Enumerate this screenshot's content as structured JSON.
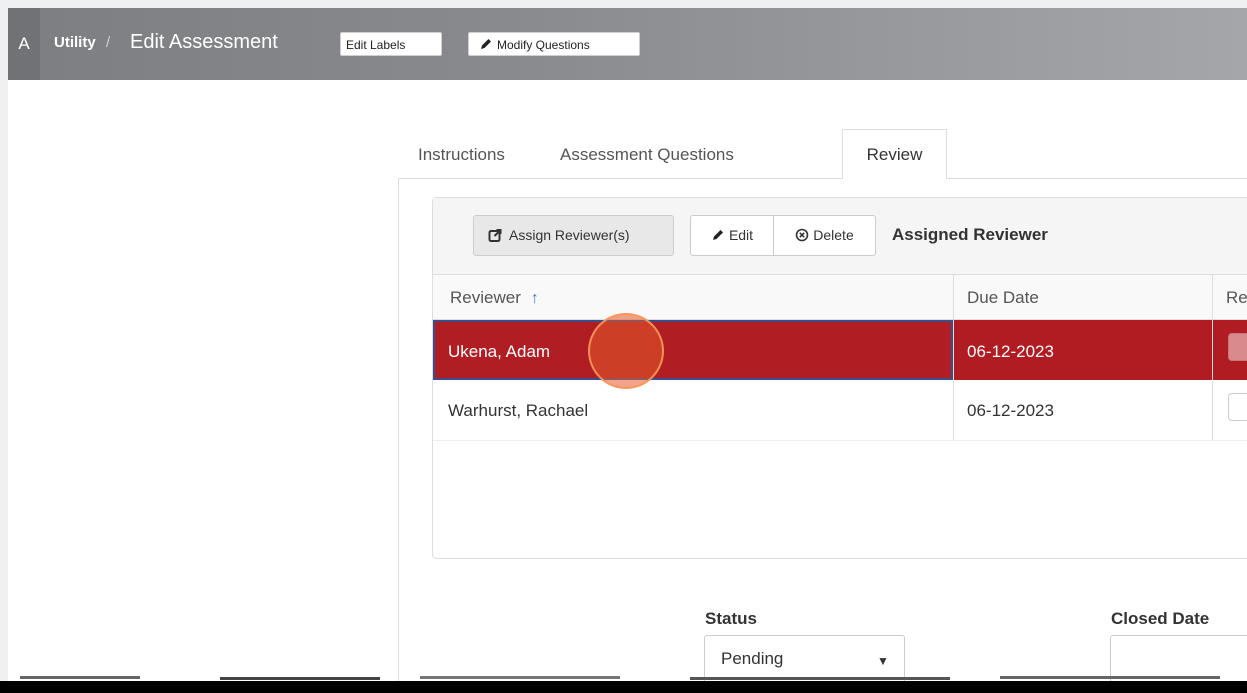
{
  "header": {
    "app_abbr": "A",
    "breadcrumb": {
      "section": "Utility",
      "separator": "/",
      "title": "Edit Assessment"
    },
    "buttons": {
      "edit_labels": "Edit Labels",
      "modify_questions": "Modify Questions"
    }
  },
  "tabs": [
    {
      "label": "Instructions",
      "active": false
    },
    {
      "label": "Assessment Questions",
      "active": false
    },
    {
      "label": "Review",
      "active": true
    }
  ],
  "reviewer_panel": {
    "title": "Assigned Reviewer",
    "buttons": {
      "assign": "Assign Reviewer(s)",
      "edit": "Edit",
      "delete": "Delete"
    },
    "columns": [
      "Reviewer",
      "Due Date",
      "Re"
    ],
    "sort_icon": "arrow-up-icon",
    "rows": [
      {
        "reviewer": "Ukena, Adam",
        "due_date": "06-12-2023",
        "selected": true
      },
      {
        "reviewer": "Warhurst, Rachael",
        "due_date": "06-12-2023",
        "selected": false
      }
    ]
  },
  "form": {
    "status_label": "Status",
    "status_value": "Pending",
    "closed_date_label": "Closed Date",
    "closed_date_value": ""
  },
  "colors": {
    "selected_row": "#b11b22",
    "topbar": "#8a8b8f",
    "sort_arrow": "#3a7bd5",
    "click_indicator": "#e65a28"
  }
}
